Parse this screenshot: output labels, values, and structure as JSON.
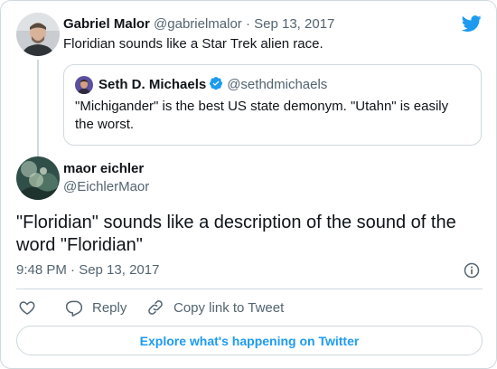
{
  "parent_tweet": {
    "author_name": "Gabriel Malor",
    "author_handle": "@gabrielmalor",
    "separator": "·",
    "date": "Sep 13, 2017",
    "text": "Floridian sounds like a Star Trek alien race."
  },
  "quoted_tweet": {
    "author_name": "Seth D. Michaels",
    "author_handle": "@sethdmichaels",
    "text": "\"Michigander\" is the best US state demonym. \"Utahn\" is easily the worst."
  },
  "main_tweet": {
    "author_name": "maor eichler",
    "author_handle": "@EichlerMaor",
    "text": "\"Floridian\" sounds like a description of the sound of the word \"Floridian\"",
    "timestamp": "9:48 PM · Sep 13, 2017"
  },
  "actions": {
    "reply_label": "Reply",
    "copy_label": "Copy link to Tweet"
  },
  "explore_label": "Explore what's happening on Twitter",
  "colors": {
    "accent": "#1d9bf0",
    "text": "#0f1419",
    "secondary": "#536471",
    "border": "#cfd9de"
  },
  "icons": [
    "twitter-bird-icon",
    "verified-badge-icon",
    "info-icon",
    "heart-icon",
    "reply-icon",
    "link-icon"
  ]
}
